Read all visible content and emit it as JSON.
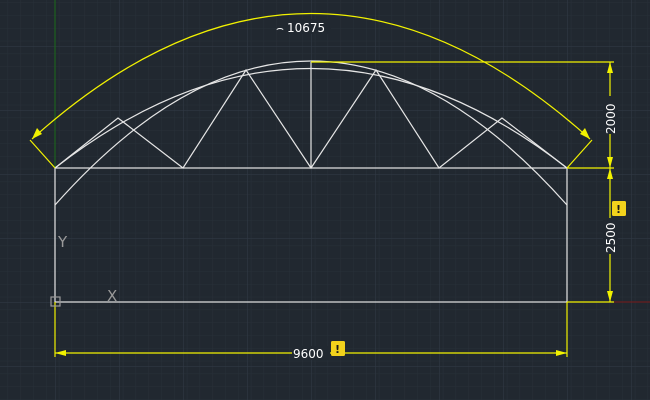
{
  "drawing": {
    "colors": {
      "background": "#212830",
      "grid_minor": "#283039",
      "grid_major": "#323b47",
      "geometry": "#e6e6e6",
      "dimension": "#f2f200",
      "warning_badge": "#f2d21c",
      "ucs_icon": "#9a9a9a",
      "axis_y": "#1a6b1a",
      "axis_x": "#7a1a1a"
    },
    "ucs": {
      "y_label": "Y",
      "x_label": "X"
    },
    "dimensions": {
      "arc_length": {
        "symbol": "⌢",
        "value": "10675"
      },
      "width": {
        "value": "9600",
        "has_warning": true
      },
      "truss_height": {
        "value": "2000"
      },
      "wall_height": {
        "value": "2500",
        "has_warning": true
      }
    },
    "warning_badge_label": "!"
  }
}
